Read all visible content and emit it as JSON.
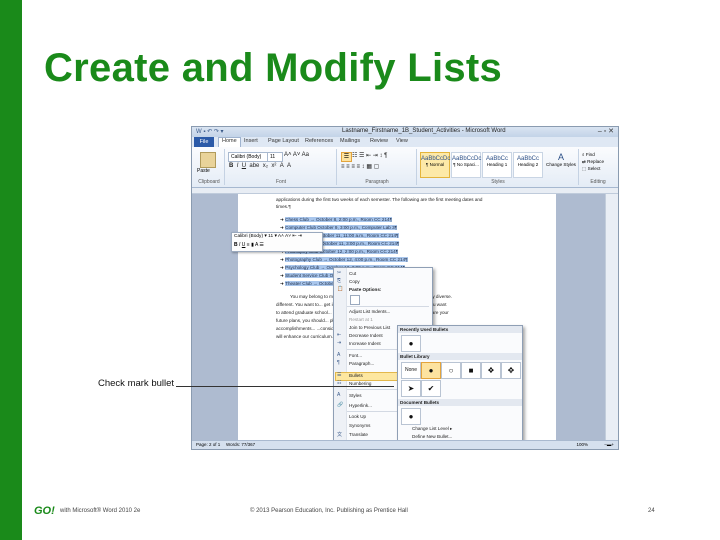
{
  "slide": {
    "title": "Create and Modify Lists",
    "callout": "Check mark bullet",
    "footer_logo": "GO!",
    "footer_left": "with Microsoft® Word 2010 2e",
    "footer_center": "© 2013 Pearson Education, Inc. Publishing as Prentice Hall",
    "page_number": "24",
    "accent_color": "#1a8a1a"
  },
  "word": {
    "window_title": "Lastname_Firstname_1B_Student_Activities - Microsoft Word",
    "tabs": [
      "File",
      "Home",
      "Insert",
      "Page Layout",
      "References",
      "Mailings",
      "Review",
      "View"
    ],
    "active_tab": "Home",
    "ribbon": {
      "font_name": "Calibri (Body)",
      "font_size": "11",
      "paste_label": "Paste",
      "groups": [
        "Clipboard",
        "Font",
        "Paragraph",
        "Styles",
        "Editing"
      ],
      "styles": [
        "¶ Normal",
        "¶ No Spaci...",
        "Heading 1",
        "Heading 2"
      ],
      "style_previews": [
        "AaBbCcDc",
        "AaBbCcDc",
        "AaBbCc",
        "AaBbCc"
      ],
      "change_styles": "Change Styles",
      "editing_items": [
        "Find",
        "Replace",
        "Select"
      ]
    },
    "doc": {
      "line1": "applications during the first two weeks of each semester. The following are the first meeting dates and",
      "line2": "times.¶",
      "bullets": [
        "Chess Club → October 8, 2:00 p.m., Room CC 214¶",
        "Computer Club October 9, 3:00 p.m., Computer Lab 3¶",
        "Cycling Club → October 11, 11:00 a.m., Room CC 214¶",
        "Honor Society → October 11, 3:00 p.m., Room CC 214¶",
        "Philosophy Club October 12, 2:00 p.m., Room CC 214¶",
        "Photography Club → October 12, 4:00 p.m., Room CC 214¶",
        "Psychology Club → October 13, 2:00 p.m., Room CC 214¶",
        "Student Service Club October 14, 12:00 p.m., Room CC 214¶",
        "Theater Club → October 14, 4:00 p.m., Theater¶"
      ],
      "para": [
        "You may belong to more than one club. Our club list is long, and is very diverse.",
        "different. You want to... get involved in... getting a degree out of it... Maybe you want",
        "to attend graduate school... so join now when you leave Lake College. What are your",
        "future plans, you should... plan...",
        "accomplishments... ...consider... Many clubs...",
        "will enhance our curriculum..."
      ]
    },
    "context_menu": [
      "Cut",
      "Copy",
      "Paste Options:",
      "",
      "Adjust List Indents...",
      "Restart at 1",
      "Join to Previous List",
      "Decrease Indent",
      "Increase Indent",
      "Font...",
      "Paragraph...",
      "Bullets",
      "Numbering",
      "Styles",
      "Hyperlink...",
      "Look Up",
      "Synonyms",
      "Translate",
      "Additional Actions"
    ],
    "bullet_menu": {
      "recent_header": "Recently Used Bullets",
      "library_header": "Bullet Library",
      "document_header": "Document Bullets",
      "none_label": "None",
      "change_level": "Change List Level",
      "define_new": "Define New Bullet...",
      "library_glyphs": [
        "None",
        "●",
        "○",
        "■",
        "❖",
        "✥"
      ],
      "library_glyphs_row2": [
        "➤",
        "✔"
      ],
      "recent_glyph": "●",
      "document_glyph": "●"
    },
    "status": {
      "page": "Page: 2 of 1",
      "words": "Words: 77/367",
      "zoom": "100%"
    }
  }
}
